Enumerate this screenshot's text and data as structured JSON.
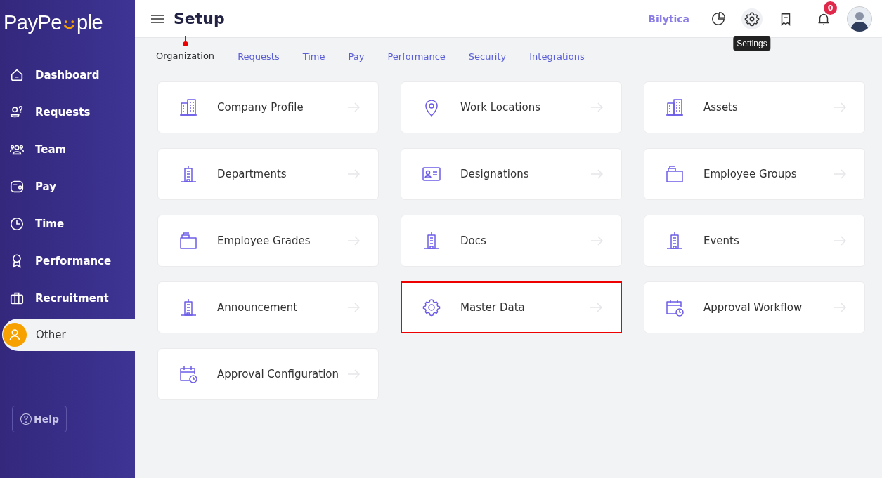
{
  "sidebar": {
    "logo": {
      "text_start": "PayPe",
      "text_end": "ple"
    },
    "items": [
      {
        "label": "Dashboard",
        "kind": "home",
        "selected": false
      },
      {
        "label": "Requests",
        "kind": "request",
        "selected": false
      },
      {
        "label": "Team",
        "kind": "team",
        "selected": false
      },
      {
        "label": "Pay",
        "kind": "wallet",
        "selected": false
      },
      {
        "label": "Time",
        "kind": "clock",
        "selected": false
      },
      {
        "label": "Performance",
        "kind": "award",
        "selected": false
      },
      {
        "label": "Recruitment",
        "kind": "briefcase",
        "selected": false
      },
      {
        "label": "Other",
        "kind": "user",
        "selected": true
      }
    ],
    "help": "Help"
  },
  "header": {
    "title": "Setup",
    "company": "Bilytica",
    "notification_count": "0",
    "tooltip": "Settings"
  },
  "tabs": [
    {
      "label": "Organization",
      "selected": true
    },
    {
      "label": "Requests",
      "selected": false
    },
    {
      "label": "Time",
      "selected": false
    },
    {
      "label": "Pay",
      "selected": false
    },
    {
      "label": "Performance",
      "selected": false
    },
    {
      "label": "Security",
      "selected": false
    },
    {
      "label": "Integrations",
      "selected": false
    }
  ],
  "cards": [
    {
      "label": "Company Profile",
      "kind": "building",
      "highlighted": false
    },
    {
      "label": "Work Locations",
      "kind": "pin",
      "highlighted": false
    },
    {
      "label": "Assets",
      "kind": "building",
      "highlighted": false
    },
    {
      "label": "Departments",
      "kind": "tower",
      "highlighted": false
    },
    {
      "label": "Designations",
      "kind": "idcard",
      "highlighted": false
    },
    {
      "label": "Employee Groups",
      "kind": "folder",
      "highlighted": false
    },
    {
      "label": "Employee Grades",
      "kind": "folder",
      "highlighted": false
    },
    {
      "label": "Docs",
      "kind": "tower",
      "highlighted": false
    },
    {
      "label": "Events",
      "kind": "tower",
      "highlighted": false
    },
    {
      "label": "Announcement",
      "kind": "tower",
      "highlighted": false
    },
    {
      "label": "Master Data",
      "kind": "gear",
      "highlighted": true
    },
    {
      "label": "Approval Workflow",
      "kind": "calendar",
      "highlighted": false
    },
    {
      "label": "Approval Configuration",
      "kind": "calendar",
      "highlighted": false
    }
  ]
}
